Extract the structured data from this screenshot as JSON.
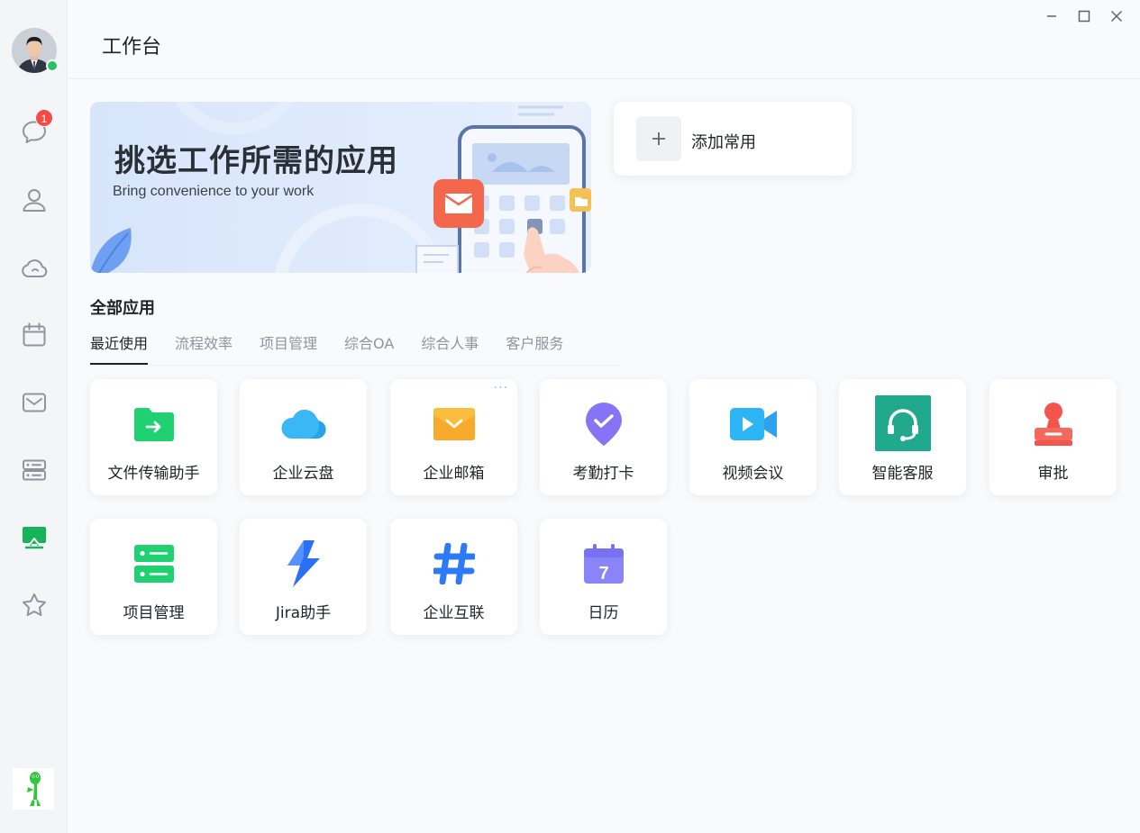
{
  "window": {
    "title": "工作台",
    "controls": [
      "minimize-icon",
      "maximize-icon",
      "close-icon"
    ]
  },
  "rail": {
    "items": [
      {
        "name": "messages",
        "icon": "chat-bubble-icon",
        "badge": "1"
      },
      {
        "name": "contacts",
        "icon": "person-icon"
      },
      {
        "name": "cloud",
        "icon": "cloud-icon"
      },
      {
        "name": "calendar",
        "icon": "calendar-icon"
      },
      {
        "name": "mail",
        "icon": "mail-icon"
      },
      {
        "name": "server",
        "icon": "server-icon"
      },
      {
        "name": "workbench",
        "icon": "workbench-icon",
        "active": true
      },
      {
        "name": "favorites",
        "icon": "star-icon"
      }
    ],
    "active_color": "#16b35a",
    "icon_color": "#8f959e",
    "online_color": "#22c55e"
  },
  "banner": {
    "title": "挑选工作所需的应用",
    "subtitle": "Bring convenience to your work"
  },
  "add_card": {
    "label": "添加常用"
  },
  "section": {
    "title": "全部应用",
    "tabs": [
      {
        "label": "最近使用",
        "active": true
      },
      {
        "label": "流程效率"
      },
      {
        "label": "项目管理"
      },
      {
        "label": "综合OA"
      },
      {
        "label": "综合人事"
      },
      {
        "label": "客户服务"
      }
    ]
  },
  "apps": [
    {
      "label": "文件传输助手",
      "icon": "folder-transfer-icon"
    },
    {
      "label": "企业云盘",
      "icon": "cloud-drive-icon"
    },
    {
      "label": "企业邮箱",
      "icon": "mailbox-icon",
      "more": "···"
    },
    {
      "label": "考勤打卡",
      "icon": "checkin-pin-icon"
    },
    {
      "label": "视频会议",
      "icon": "video-camera-icon"
    },
    {
      "label": "智能客服",
      "icon": "headset-icon"
    },
    {
      "label": "审批",
      "icon": "stamp-icon"
    },
    {
      "label": "项目管理",
      "icon": "project-server-icon"
    },
    {
      "label": "Jira助手",
      "icon": "jira-icon"
    },
    {
      "label": "企业互联",
      "icon": "hashtag-icon"
    },
    {
      "label": "日历",
      "icon": "calendar-7-icon",
      "day": "7"
    }
  ]
}
